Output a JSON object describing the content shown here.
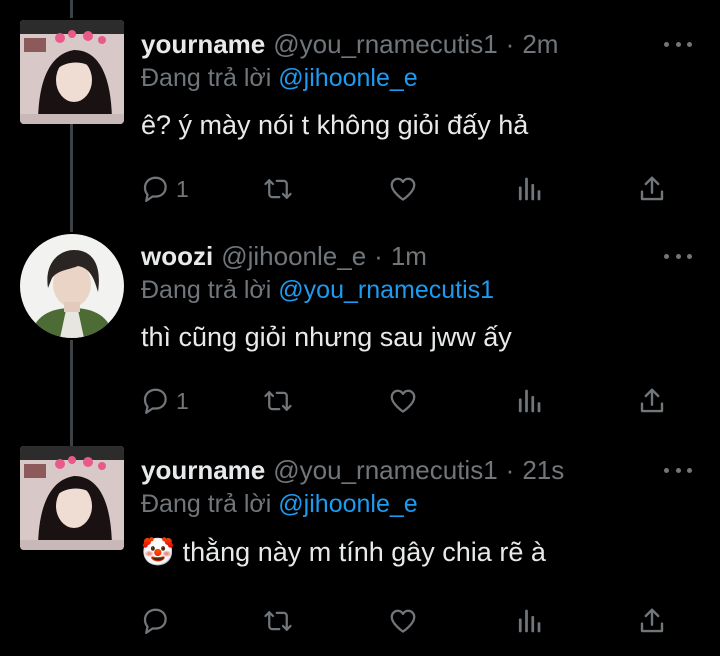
{
  "tweets": [
    {
      "display_name": "yourname",
      "handle": "@you_rnamecutis1",
      "separator": "·",
      "time": "2m",
      "reply_prefix": "Đang trả lời",
      "reply_to": "@jihoonle_e",
      "text": "ê? ý mày nói t không giỏi đấy hả",
      "emoji": "",
      "reply_count": "1",
      "avatar": "girl-photo-avatar"
    },
    {
      "display_name": "woozi",
      "handle": "@jihoonle_e",
      "separator": "·",
      "time": "1m",
      "reply_prefix": "Đang trả lời",
      "reply_to": "@you_rnamecutis1",
      "text": "thì cũng giỏi nhưng sau jww ấy",
      "emoji": "",
      "reply_count": "1",
      "avatar": "boy-photo-avatar"
    },
    {
      "display_name": "yourname",
      "handle": "@you_rnamecutis1",
      "separator": "·",
      "time": "21s",
      "reply_prefix": "Đang trả lời",
      "reply_to": "@jihoonle_e",
      "text": "thằng này m tính gây chia rẽ à",
      "emoji": "🤡",
      "reply_count": "",
      "avatar": "girl-photo-avatar"
    }
  ],
  "colors": {
    "background": "#000000",
    "primary_text": "#e7e9ea",
    "secondary_text": "#71767b",
    "mention": "#1d9bf0",
    "thread_line": "#3e4144"
  },
  "icons": [
    "reply-icon",
    "retweet-icon",
    "like-icon",
    "views-icon",
    "share-icon",
    "more-icon"
  ]
}
